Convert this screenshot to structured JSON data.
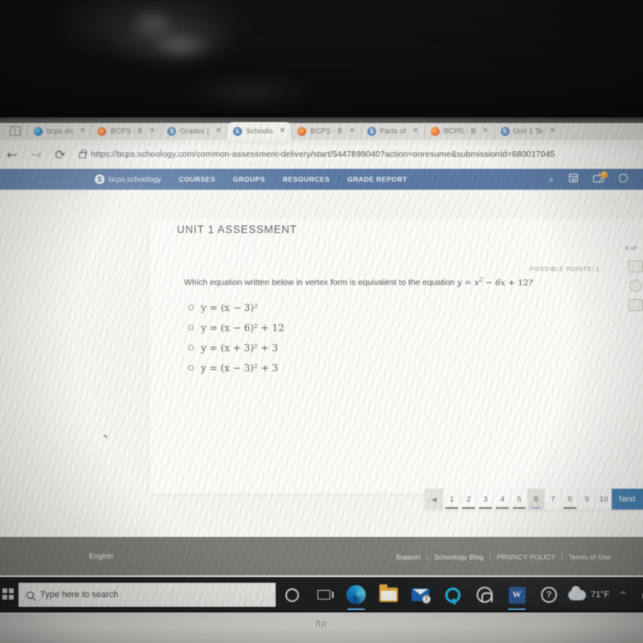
{
  "browser": {
    "tabs": [
      {
        "label": "bcps on",
        "favicon": "edge-favicon",
        "active": false
      },
      {
        "label": "BCPS - B",
        "favicon": "firefox-favicon",
        "active": false
      },
      {
        "label": "Grades |",
        "favicon": "schoology-favicon",
        "active": false
      },
      {
        "label": "Schoolo",
        "favicon": "schoology-favicon",
        "active": true
      },
      {
        "label": "BCPS - B",
        "favicon": "firefox-favicon",
        "active": false
      },
      {
        "label": "Parts of",
        "favicon": "schoology-favicon",
        "active": false
      },
      {
        "label": "BCPS - B",
        "favicon": "firefox-favicon",
        "active": false
      },
      {
        "label": "Unit 1 Te",
        "favicon": "schoology-favicon",
        "active": false
      }
    ],
    "tab_close_glyph": "✕",
    "back_glyph": "←",
    "forward_glyph": "→",
    "reload_glyph": "⟳",
    "url": "https://bcps.schoology.com/common-assessment-delivery/start/5447898040?action=onresume&submissionId=680017045"
  },
  "site_nav": {
    "brand_mark": "S",
    "brand": "bcps.schoology",
    "items": [
      "COURSES",
      "GROUPS",
      "RESOURCES",
      "GRADE REPORT"
    ],
    "icons": [
      "search-icon",
      "calendar-icon",
      "messages-icon",
      "notifications-icon"
    ],
    "search_glyph": "⌕",
    "messages_badge": "4"
  },
  "assessment": {
    "title": "UNIT 1 ASSESSMENT",
    "question_counter": "6 of",
    "possible_points": "POSSIBLE POINTS: 1",
    "question_lead": "Which equation written below in vertex form is equivalent to the equation",
    "question_equation": "y = x² − 6x + 12?",
    "choices": [
      {
        "text": "y = (x − 3)²",
        "selected": false
      },
      {
        "text": "y = (x − 6)² + 12",
        "selected": false
      },
      {
        "text": "y = (x + 3)² + 3",
        "selected": false
      },
      {
        "text": "y = (x − 3)² + 3",
        "selected": false
      }
    ]
  },
  "pager": {
    "prev_glyph": "◀",
    "pages": [
      {
        "n": "1",
        "answered": true,
        "current": false
      },
      {
        "n": "2",
        "answered": true,
        "current": false
      },
      {
        "n": "3",
        "answered": true,
        "current": false
      },
      {
        "n": "4",
        "answered": true,
        "current": false
      },
      {
        "n": "5",
        "answered": true,
        "current": false
      },
      {
        "n": "6",
        "answered": false,
        "current": true
      },
      {
        "n": "7",
        "answered": false,
        "current": false
      },
      {
        "n": "8",
        "answered": true,
        "current": false
      },
      {
        "n": "9",
        "answered": false,
        "current": false
      },
      {
        "n": "10",
        "answered": false,
        "current": false
      }
    ],
    "next_label": "Next",
    "accent_color": "#3f7cb0"
  },
  "footer": {
    "language": "English",
    "links": [
      "Support",
      "Schoology Blog",
      "PRIVACY POLICY",
      "Terms of Use"
    ],
    "separator": "|"
  },
  "taskbar": {
    "search_placeholder": "Type here to search",
    "search_icon": "magnifier-icon",
    "cortana_icon": "cortana-circle-icon",
    "taskview_icon": "task-view-icon",
    "apps": [
      {
        "name": "edge-icon",
        "badge": ""
      },
      {
        "name": "file-explorer-icon",
        "badge": ""
      },
      {
        "name": "mail-icon",
        "badge": "1"
      },
      {
        "name": "alexa-icon",
        "badge": ""
      },
      {
        "name": "hp-jumpstart-icon",
        "badge": ""
      },
      {
        "name": "word-icon",
        "badge": "",
        "glyph": "W"
      },
      {
        "name": "help-icon",
        "badge": "",
        "glyph": "?"
      }
    ],
    "weather_temp": "71°F",
    "weather_icon": "cloud-icon",
    "chevron": "︿"
  },
  "device": {
    "brand": "hp"
  }
}
